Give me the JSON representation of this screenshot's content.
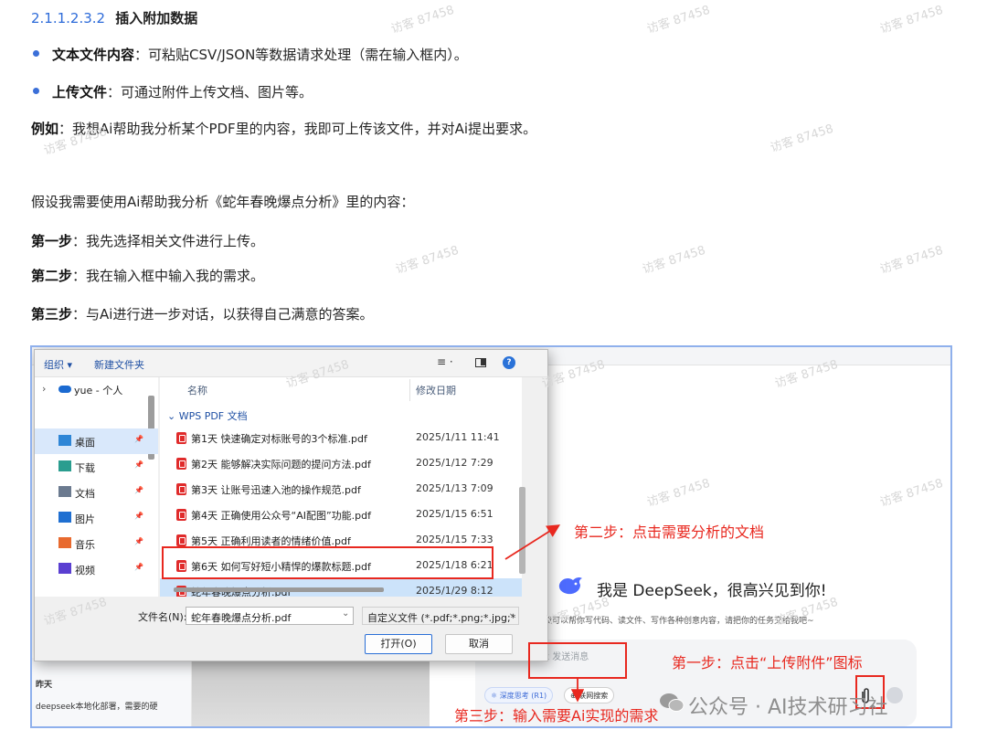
{
  "section": {
    "number": "2.1.1.2.3.2",
    "title": "插入附加数据"
  },
  "bullets": [
    {
      "term": "文本文件内容",
      "text": "：可粘贴CSV/JSON等数据请求处理（需在输入框内）。"
    },
    {
      "term": "上传文件",
      "text": "：可通过附件上传文档、图片等。"
    }
  ],
  "example": {
    "term": "例如",
    "text": "：我想Ai帮助我分析某个PDF里的内容，我即可上传该文件，并对Ai提出要求。"
  },
  "intro": "假设我需要使用Ai帮助我分析《蛇年春晚爆点分析》里的内容：",
  "steps": [
    {
      "term": "第一步",
      "text": "：我先选择相关文件进行上传。"
    },
    {
      "term": "第二步",
      "text": "：我在输入框中输入我的需求。"
    },
    {
      "term": "第三步",
      "text": "：与Ai进行进一步对话，以获得自己满意的答案。"
    }
  ],
  "watermark": "访客 87458",
  "dialog": {
    "toolbar": {
      "organize": "组织 ▾",
      "new_folder": "新建文件夹",
      "view": "≡ ·",
      "help": "?"
    },
    "tree_root": "yue - 个人",
    "sidebar": [
      {
        "label": "桌面",
        "icon": "desktop-icon",
        "color": "#2f86d6",
        "selected": true
      },
      {
        "label": "下载",
        "icon": "download-icon",
        "color": "#2a9d8f"
      },
      {
        "label": "文档",
        "icon": "document-icon",
        "color": "#6b7a8f"
      },
      {
        "label": "图片",
        "icon": "pictures-icon",
        "color": "#1f6fd1"
      },
      {
        "label": "音乐",
        "icon": "music-icon",
        "color": "#e86a2f"
      },
      {
        "label": "视频",
        "icon": "video-icon",
        "color": "#5a3fd1"
      }
    ],
    "columns": {
      "name": "名称",
      "date": "修改日期"
    },
    "group": "WPS PDF 文档",
    "files": [
      {
        "name": "第1天 快速确定对标账号的3个标准.pdf",
        "date": "2025/1/11 11:41"
      },
      {
        "name": "第2天 能够解决实际问题的提问方法.pdf",
        "date": "2025/1/12 7:29"
      },
      {
        "name": "第3天 让账号迅速入池的操作规范.pdf",
        "date": "2025/1/13 7:09"
      },
      {
        "name": "第4天  正确使用公众号“AI配图”功能.pdf",
        "date": "2025/1/15 6:51"
      },
      {
        "name": "第5天  正确利用读者的情绪价值.pdf",
        "date": "2025/1/15 7:33"
      },
      {
        "name": "第6天 如何写好短小精悍的爆款标题.pdf",
        "date": "2025/1/18 6:21"
      },
      {
        "name": "蛇年春晚爆点分析.pdf",
        "date": "2025/1/29 8:12",
        "selected": true
      }
    ],
    "filename_label": "文件名(N):",
    "filename_value": "蛇年春晚爆点分析.pdf",
    "filter_value": "自定义文件 (*.pdf;*.png;*.jpg;*",
    "open_button": "打开(O)",
    "cancel_button": "取消"
  },
  "deepseek": {
    "greeting": "我是 DeepSeek，很高兴见到你!",
    "subtitle": "我可以帮你写代码、读文件、写作各种创意内容，请把你的任务交给我吧~",
    "input_placeholder": "eek 发送消息",
    "chip_think": "深度思考 (R1)",
    "chip_search": "联网搜索",
    "history_day": "昨天",
    "history_item": "deepseek本地化部署，需要的硬"
  },
  "annotations": {
    "step1": "第一步：点击“上传附件”图标",
    "step2": "第二步：点击需要分析的文档",
    "step3": "第三步：输入需要Ai实现的需求"
  },
  "wechat_mark": "公众号 · AI技术研习社",
  "colors": {
    "accent_blue": "#2d6bd9",
    "annotation_red": "#e8281f",
    "frame_border": "#8fb0ec"
  }
}
